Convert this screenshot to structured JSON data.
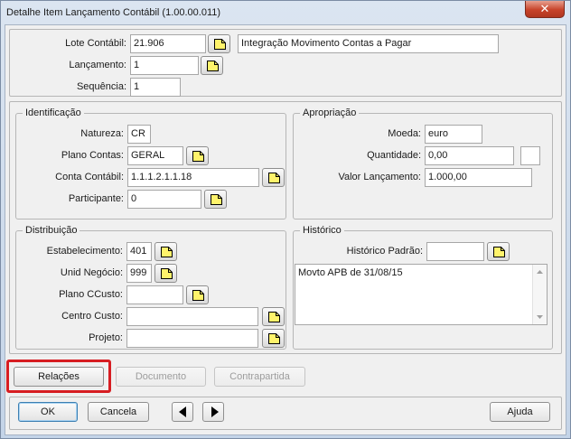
{
  "window": {
    "title": "Detalhe Item Lançamento Contábil (1.00.00.011)",
    "close_glyph": "✕"
  },
  "header": {
    "lote_label": "Lote Contábil:",
    "lote_value": "21.906",
    "lote_description": "Integração Movimento Contas a Pagar",
    "lancamento_label": "Lançamento:",
    "lancamento_value": "1",
    "sequencia_label": "Sequência:",
    "sequencia_value": "1"
  },
  "identificacao": {
    "legend": "Identificação",
    "natureza_label": "Natureza:",
    "natureza_value": "CR",
    "plano_contas_label": "Plano Contas:",
    "plano_contas_value": "GERAL",
    "conta_contabil_label": "Conta Contábil:",
    "conta_contabil_value": "1.1.1.2.1.1.18",
    "participante_label": "Participante:",
    "participante_value": "0"
  },
  "apropriacao": {
    "legend": "Apropriação",
    "moeda_label": "Moeda:",
    "moeda_value": "euro",
    "quantidade_label": "Quantidade:",
    "quantidade_value": "0,00",
    "quantidade_unit": "",
    "valor_label": "Valor Lançamento:",
    "valor_value": "1.000,00"
  },
  "distribuicao": {
    "legend": "Distribuição",
    "estabelecimento_label": "Estabelecimento:",
    "estabelecimento_value": "401",
    "unid_negocio_label": "Unid Negócio:",
    "unid_negocio_value": "999",
    "plano_ccusto_label": "Plano CCusto:",
    "plano_ccusto_value": "",
    "centro_custo_label": "Centro Custo:",
    "centro_custo_value": "",
    "projeto_label": "Projeto:",
    "projeto_value": ""
  },
  "historico": {
    "legend": "Histórico",
    "padrao_label": "Histórico Padrão:",
    "padrao_value": "",
    "text": "Movto APB de 31/08/15"
  },
  "actions": {
    "relacoes": "Relações",
    "documento": "Documento",
    "contrapartida": "Contrapartida"
  },
  "footer": {
    "ok": "OK",
    "cancela": "Cancela",
    "ajuda": "Ajuda"
  },
  "colors": {
    "highlight": "#d71d22",
    "zoom_icon_fill": "#fff36b"
  }
}
